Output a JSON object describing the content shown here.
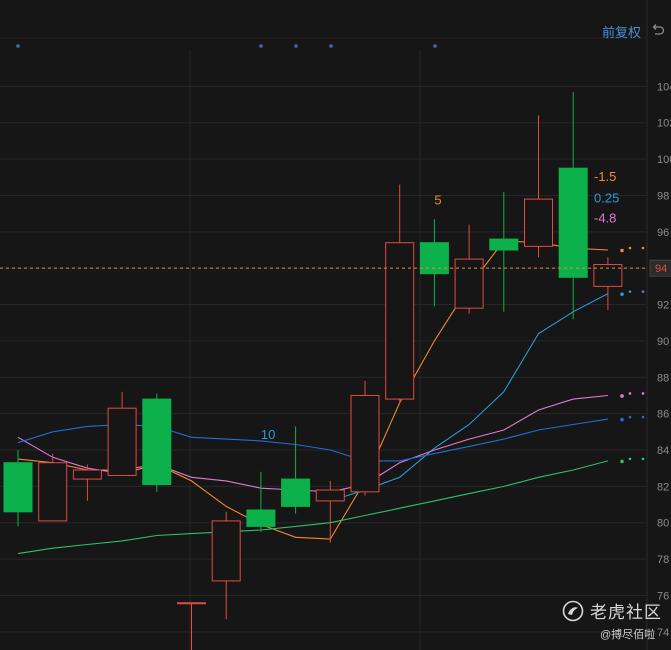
{
  "toolbar": {
    "adjust_label": "前复权"
  },
  "watermark": {
    "brand": "老虎社区",
    "user": "@搏尽佰啦"
  },
  "colors": {
    "up": "#e24c42",
    "down": "#0db14b",
    "ma1": "#f08b2a",
    "ma2": "#2a9ad8",
    "ma3": "#e07ad6",
    "ma4": "#1f6fd0",
    "ma5": "#2fbf72",
    "grid": "#262626",
    "axis_text": "#8c8c8c",
    "price_line": "#e08f3a",
    "price_tag": "#e24c42"
  },
  "chart_data": {
    "type": "candlestick",
    "ylim": [
      73.0,
      106.0
    ],
    "y_ticks": [
      {
        "value": 104.0,
        "label": "104"
      },
      {
        "value": 102.0,
        "label": "102"
      },
      {
        "value": 100.0,
        "label": "100"
      },
      {
        "value": 98.0,
        "label": "98"
      },
      {
        "value": 96.0,
        "label": "96"
      },
      {
        "value": 94.0,
        "label": "94"
      },
      {
        "value": 92.0,
        "label": "92"
      },
      {
        "value": 90.0,
        "label": "90"
      },
      {
        "value": 88.0,
        "label": "88"
      },
      {
        "value": 86.0,
        "label": "86"
      },
      {
        "value": 84.0,
        "label": "84"
      },
      {
        "value": 82.0,
        "label": "82"
      },
      {
        "value": 80.0,
        "label": "80"
      },
      {
        "value": 78.0,
        "label": "78"
      },
      {
        "value": 76.0,
        "label": "76"
      },
      {
        "value": 74.0,
        "label": "74"
      }
    ],
    "current_price": 94.0,
    "current_price_label": "94",
    "candles": [
      {
        "o": 83.3,
        "h": 84.0,
        "l": 79.8,
        "c": 80.6
      },
      {
        "o": 80.1,
        "h": 83.8,
        "l": 80.1,
        "c": 83.3
      },
      {
        "o": 82.4,
        "h": 83.2,
        "l": 81.2,
        "c": 82.9
      },
      {
        "o": 82.6,
        "h": 87.2,
        "l": 82.6,
        "c": 86.3
      },
      {
        "o": 86.8,
        "h": 87.1,
        "l": 81.7,
        "c": 82.1
      },
      {
        "o": 75.6,
        "h": 75.6,
        "l": 73.0,
        "c": 75.6
      },
      {
        "o": 76.8,
        "h": 80.6,
        "l": 74.7,
        "c": 80.1
      },
      {
        "o": 80.7,
        "h": 82.8,
        "l": 79.5,
        "c": 79.8
      },
      {
        "o": 82.4,
        "h": 85.3,
        "l": 80.5,
        "c": 80.9
      },
      {
        "o": 81.2,
        "h": 82.3,
        "l": 78.9,
        "c": 81.8
      },
      {
        "o": 81.7,
        "h": 87.8,
        "l": 81.5,
        "c": 87.0
      },
      {
        "o": 86.8,
        "h": 98.6,
        "l": 86.6,
        "c": 95.4
      },
      {
        "o": 95.4,
        "h": 96.7,
        "l": 91.9,
        "c": 93.7
      },
      {
        "o": 91.8,
        "h": 96.4,
        "l": 91.5,
        "c": 94.5
      },
      {
        "o": 95.6,
        "h": 98.2,
        "l": 91.6,
        "c": 95.0
      },
      {
        "o": 95.2,
        "h": 102.4,
        "l": 94.6,
        "c": 97.8
      },
      {
        "o": 99.5,
        "h": 103.7,
        "l": 91.2,
        "c": 93.5
      },
      {
        "o": 93.0,
        "h": 94.6,
        "l": 91.7,
        "c": 94.2
      }
    ],
    "ma_lines": [
      {
        "color_key": "ma1",
        "values": [
          83.5,
          83.3,
          82.9,
          82.9,
          83.2,
          82.3,
          80.9,
          79.9,
          79.2,
          79.1,
          82.3,
          86.6,
          90.0,
          93.0,
          95.5,
          95.4,
          95.1,
          95.0
        ]
      },
      {
        "color_key": "ma2",
        "values": [
          null,
          null,
          null,
          null,
          null,
          null,
          null,
          null,
          null,
          81.2,
          81.8,
          82.5,
          84.1,
          85.4,
          87.2,
          90.4,
          91.6,
          92.6
        ]
      },
      {
        "color_key": "ma3",
        "values": [
          84.7,
          83.6,
          83.0,
          82.7,
          83.2,
          82.5,
          82.3,
          81.9,
          81.8,
          81.7,
          82.1,
          83.3,
          84.0,
          84.6,
          85.1,
          86.2,
          86.8,
          87.0
        ]
      },
      {
        "color_key": "ma4",
        "values": [
          84.4,
          85.0,
          85.3,
          85.4,
          85.3,
          84.7,
          84.6,
          84.5,
          84.3,
          84.0,
          83.4,
          83.4,
          83.8,
          84.2,
          84.6,
          85.1,
          85.4,
          85.7
        ]
      },
      {
        "color_key": "ma5",
        "values": [
          78.3,
          78.6,
          78.8,
          79.0,
          79.3,
          79.4,
          79.5,
          79.6,
          79.8,
          80.0,
          80.4,
          80.8,
          81.2,
          81.6,
          82.0,
          82.5,
          82.9,
          83.4
        ]
      }
    ],
    "annotations": [
      {
        "text": "5",
        "color_key": "ma1",
        "candle": 12,
        "value": 97.5
      },
      {
        "text": "10",
        "color_key": "ma2",
        "candle": 7,
        "value": 84.6
      }
    ],
    "side_labels": [
      {
        "text": "-1.5",
        "color_key": "ma1",
        "value": 98.8
      },
      {
        "text": "0.25",
        "color_key": "ma2",
        "value": 97.6
      },
      {
        "text": "-4.8",
        "color_key": "ma3",
        "value": 96.5
      }
    ]
  }
}
